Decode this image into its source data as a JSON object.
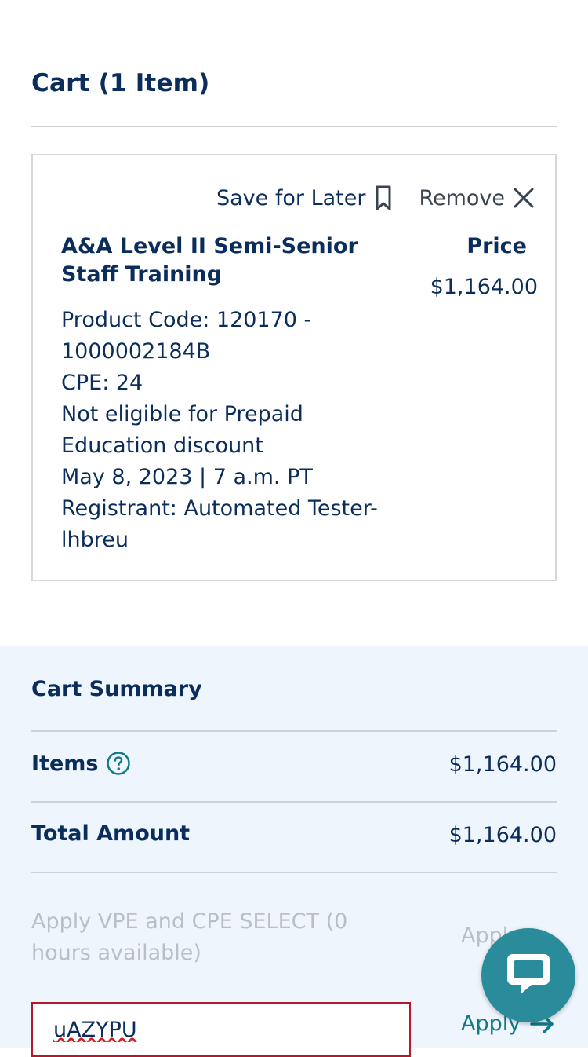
{
  "cart": {
    "title": "Cart (1 Item)"
  },
  "item": {
    "save_for_later_label": "Save for Later",
    "remove_label": "Remove",
    "product_name": "A&A Level II Semi-Senior Staff Training",
    "price_label": "Price",
    "price": "$1,164.00",
    "details": [
      "Product Code: 120170 - 1000002184B",
      "CPE: 24",
      "Not eligible for Prepaid Education discount",
      "May 8, 2023 | 7 a.m. PT",
      "Registrant: Automated Tester-lhbreu"
    ]
  },
  "summary": {
    "title": "Cart Summary",
    "items_label": "Items",
    "items_value": "$1,164.00",
    "total_label": "Total Amount",
    "total_value": "$1,164.00",
    "vpe_text": "Apply VPE and CPE SELECT (0 hours available)",
    "vpe_apply_label": "Apply",
    "promo_value": "uAZYPU",
    "promo_apply_label": "Apply"
  },
  "icons": {
    "bookmark": "bookmark-icon",
    "close": "close-icon",
    "help": "help-circle-icon",
    "arrow": "arrow-right-icon",
    "chat": "chat-bubble-icon"
  },
  "colors": {
    "navy": "#0b2d5b",
    "teal": "#0f7a86",
    "chat": "#2a8b9b",
    "summary_bg": "#eef5fc",
    "error_border": "#b3192b"
  }
}
